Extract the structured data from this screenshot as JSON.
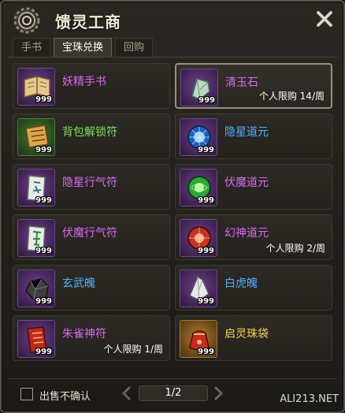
{
  "window": {
    "title": "馈灵工商"
  },
  "tabs": [
    {
      "label": "手书",
      "active": false
    },
    {
      "label": "宝珠兑换",
      "active": true
    },
    {
      "label": "回购",
      "active": false
    }
  ],
  "items": [
    {
      "name": "妖精手书",
      "qty": "999",
      "limit": "",
      "name_color": "purple",
      "icon": "book-scroll-icon",
      "frame": "purple"
    },
    {
      "name": "清玉石",
      "qty": "999",
      "limit": "个人限购 14/周",
      "name_color": "purple",
      "icon": "jade-stone-icon",
      "frame": "purple"
    },
    {
      "name": "背包解锁符",
      "qty": "999",
      "limit": "",
      "name_color": "green",
      "icon": "unlock-talisman-icon",
      "frame": "green"
    },
    {
      "name": "隐星道元",
      "qty": "999",
      "limit": "",
      "name_color": "blue",
      "icon": "blue-orb-icon",
      "frame": "purple"
    },
    {
      "name": "隐星行气符",
      "qty": "999",
      "limit": "",
      "name_color": "purple",
      "icon": "talisman-scroll-icon",
      "frame": "purple"
    },
    {
      "name": "伏魔道元",
      "qty": "999",
      "limit": "",
      "name_color": "purple",
      "icon": "green-orb-icon",
      "frame": "purple"
    },
    {
      "name": "伏魔行气符",
      "qty": "999",
      "limit": "",
      "name_color": "purple",
      "icon": "talisman-scroll-icon",
      "frame": "purple"
    },
    {
      "name": "幻神道元",
      "qty": "999",
      "limit": "个人限购 2/周",
      "name_color": "purple",
      "icon": "red-orb-icon",
      "frame": "purple"
    },
    {
      "name": "玄武魄",
      "qty": "999",
      "limit": "",
      "name_color": "blue",
      "icon": "dark-ore-icon",
      "frame": "purple"
    },
    {
      "name": "白虎魄",
      "qty": "999",
      "limit": "",
      "name_color": "blue",
      "icon": "white-crystal-icon",
      "frame": "purple"
    },
    {
      "name": "朱雀神符",
      "qty": "999",
      "limit": "个人限购 1/周",
      "name_color": "purple",
      "icon": "red-talisman-icon",
      "frame": "purple"
    },
    {
      "name": "启灵珠袋",
      "qty": "999",
      "limit": "",
      "name_color": "gold",
      "icon": "red-pouch-icon",
      "frame": "gold"
    }
  ],
  "footer": {
    "confirm_label": "出售不确认",
    "page": "1/2",
    "watermark": "ALI213.NET"
  },
  "colors": {
    "purple_name": "#d56bf0",
    "green_name": "#7de05a",
    "blue_name": "#4fb0ff",
    "gold_name": "#f2d24a"
  }
}
